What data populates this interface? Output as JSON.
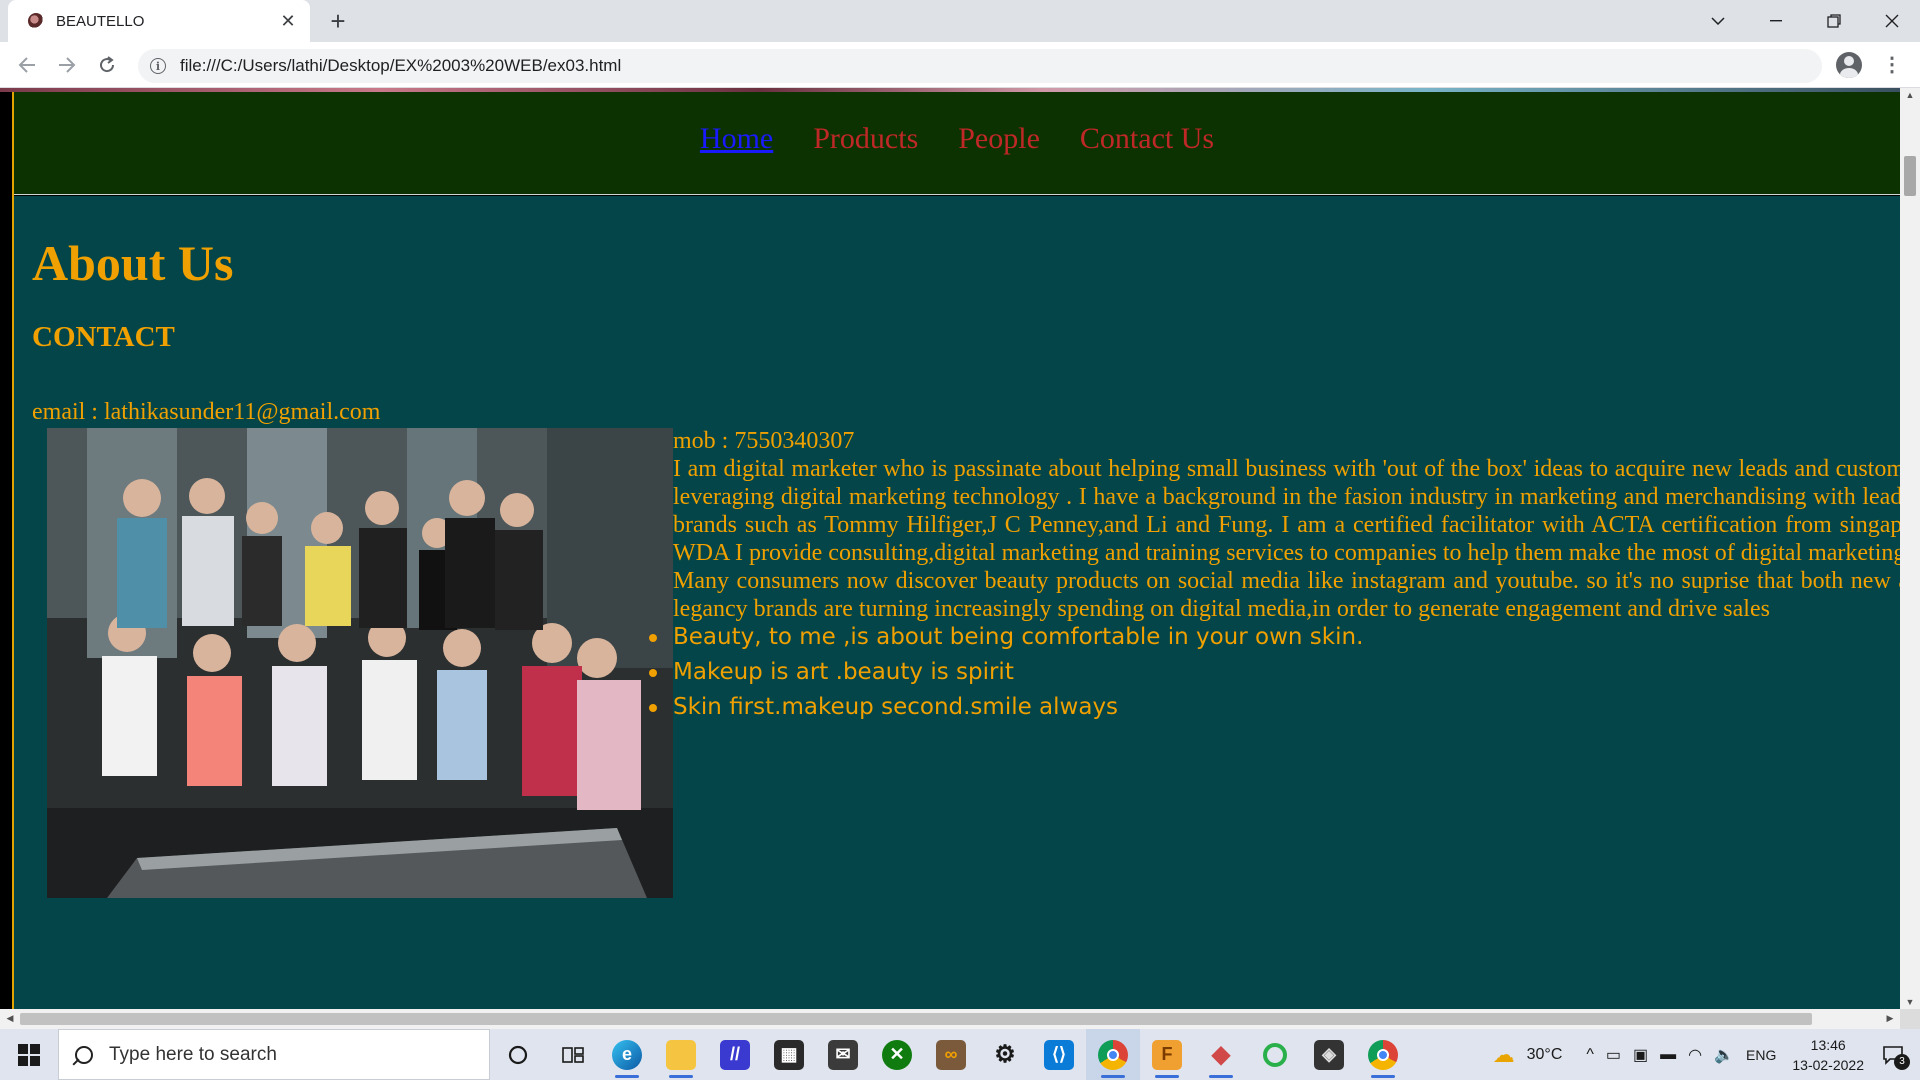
{
  "browser": {
    "tab_title": "BEAUTELLO",
    "url": "file:///C:/Users/lathi/Desktop/EX%2003%20WEB/ex03.html"
  },
  "page": {
    "nav": [
      {
        "label": "Home",
        "active": true
      },
      {
        "label": "Products",
        "active": false
      },
      {
        "label": "People",
        "active": false
      },
      {
        "label": "Contact Us",
        "active": false
      }
    ],
    "about_title": "About Us",
    "contact_heading": "CONTACT",
    "email": "email : lathikasunder11@gmail.com",
    "mobile": "mob : 7550340307",
    "paragraph1": "I am digital marketer who is passinate about helping small business with 'out of the box' ideas to acquire new leads and customers leveraging digital marketing technology . I have a background in the fasion industry in marketing and merchandising with leading brands such as Tommy Hilfiger,J C Penney,and Li and Fung. I am a certified facilitator with ACTA certification from singapore WDA I provide consulting,digital marketing and training services to companies to help them make the most of digital marketing",
    "paragraph2": "Many consumers now discover beauty products on social media like instagram and youtube. so it's no suprise that both new and legancy brands are turning increasingly spending on digital media,in order to generate engagement and drive sales",
    "quotes": [
      "Beauty, to me ,is about being comfortable in your own skin.",
      "Makeup is art .beauty is spirit",
      "Skin first.makeup second.smile always"
    ]
  },
  "taskbar": {
    "search_placeholder": "Type here to search",
    "weather": "30°C",
    "language": "ENG",
    "time": "13:46",
    "date": "13-02-2022",
    "notification_count": "3"
  }
}
